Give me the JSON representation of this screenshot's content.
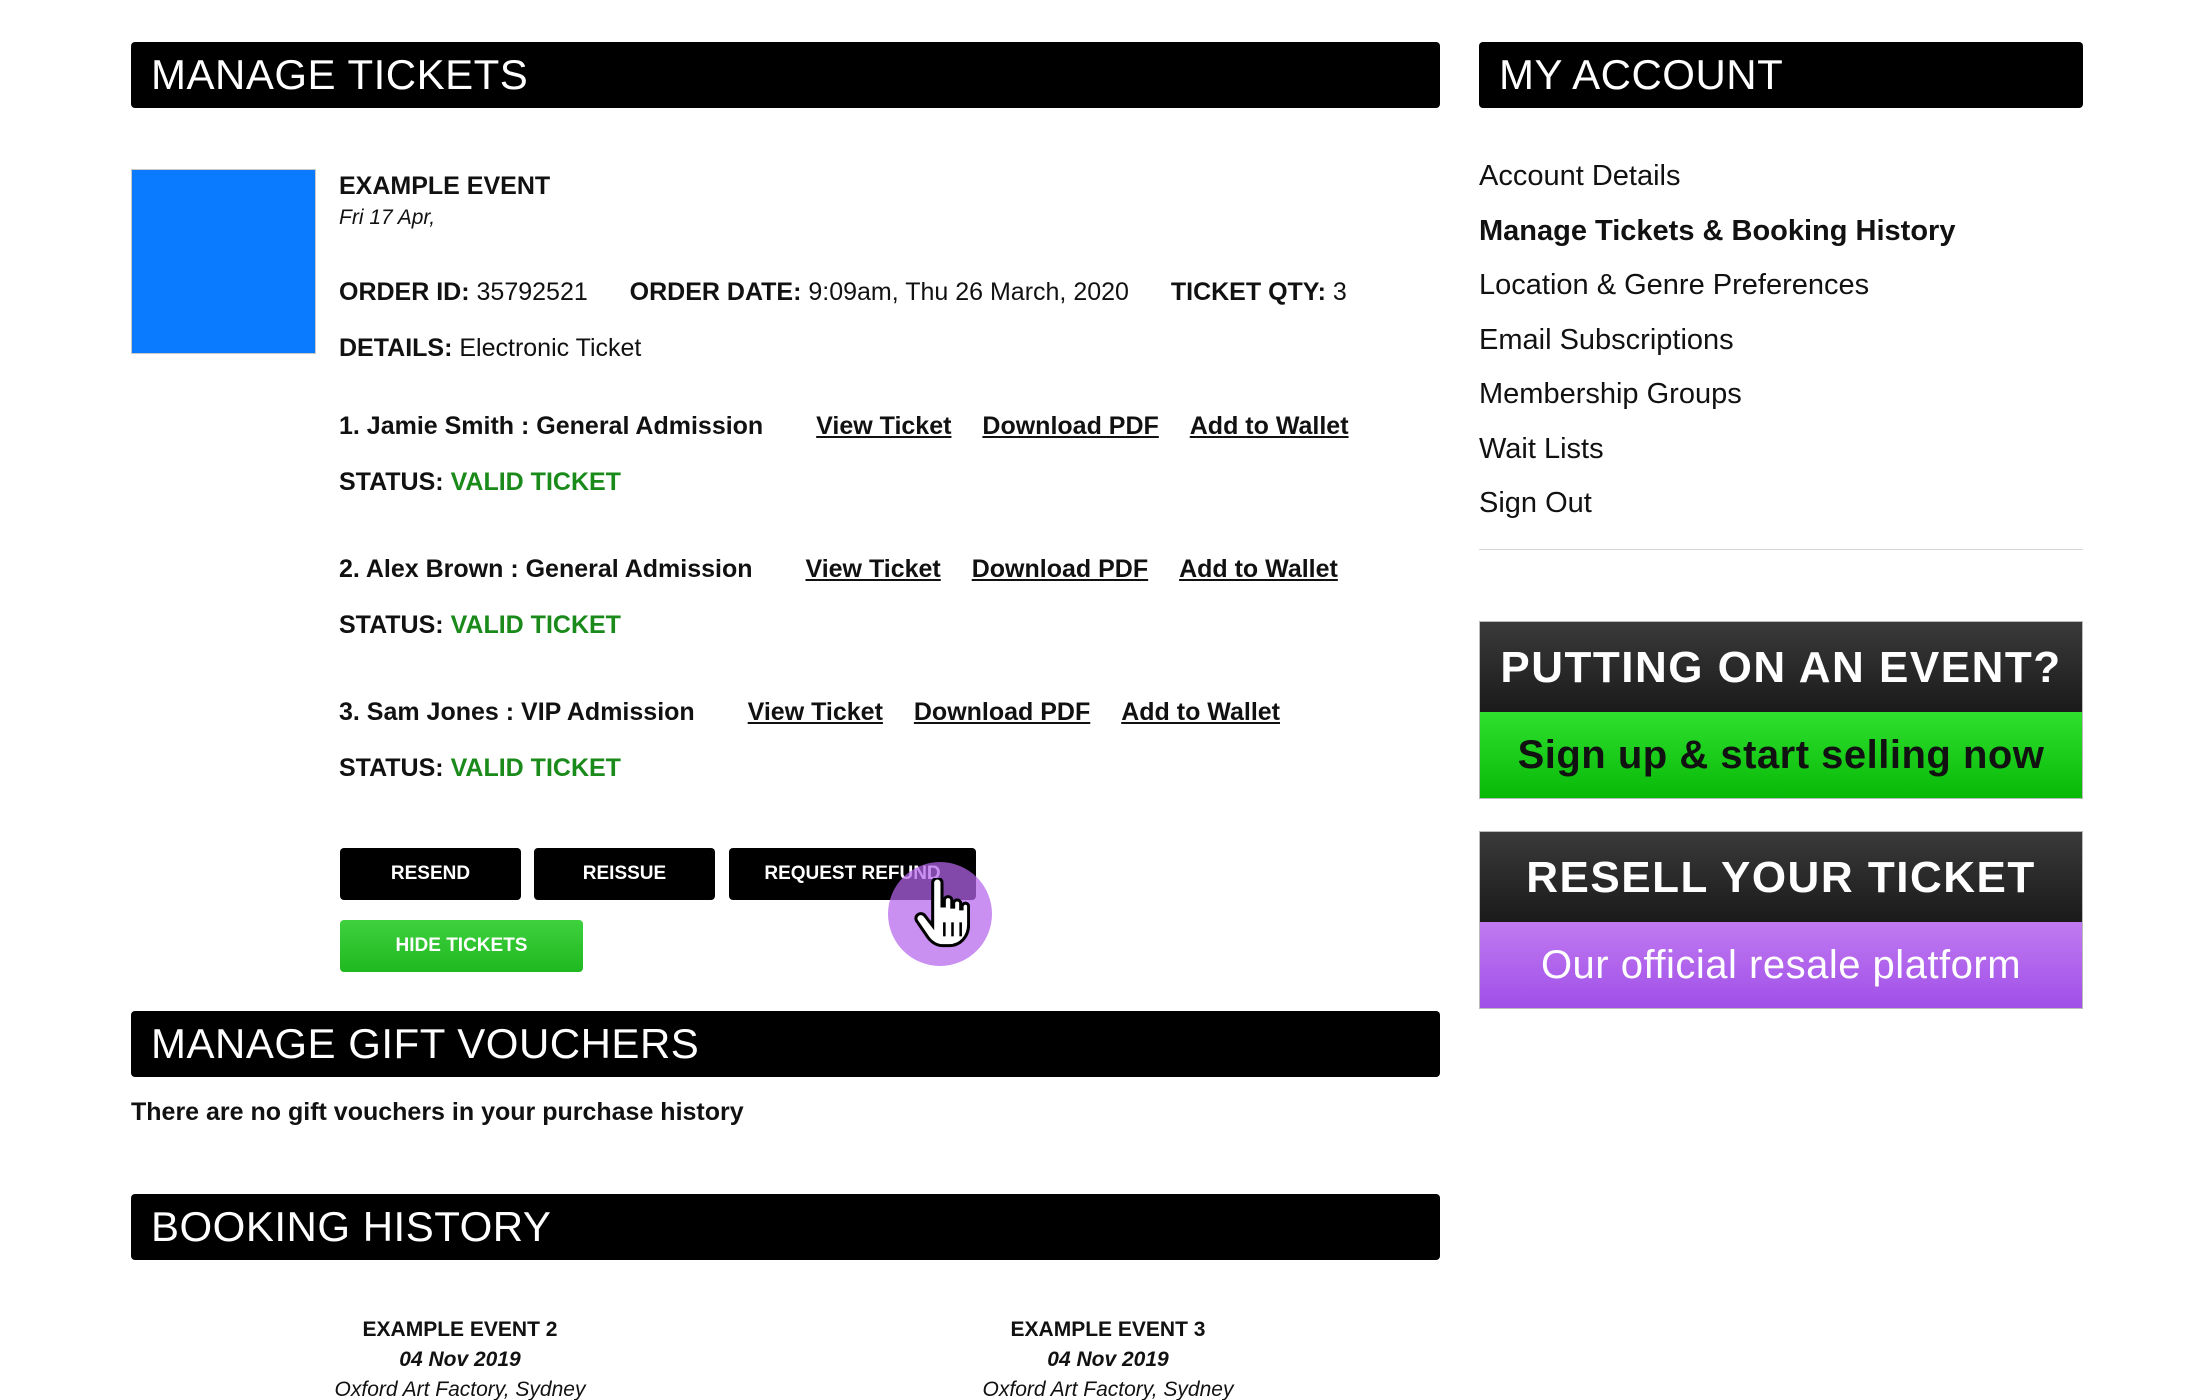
{
  "colors": {
    "event_thumbnail": "#0a7bff",
    "valid_status": "#1a8a1a",
    "hide_button": "#2ec52e",
    "resell_accent": "#a855f7"
  },
  "manage_tickets": {
    "heading": "MANAGE TICKETS",
    "event": {
      "title": "EXAMPLE EVENT",
      "date": "Fri 17 Apr,"
    },
    "order": {
      "order_id_label": "ORDER ID:",
      "order_id": "35792521",
      "order_date_label": "ORDER DATE:",
      "order_date": "9:09am, Thu 26 March, 2020",
      "qty_label": "TICKET QTY:",
      "qty": "3",
      "details_label": "DETAILS:",
      "details": "Electronic Ticket"
    },
    "tickets": [
      {
        "holder": "1. Jamie Smith : General Admission",
        "view": "View Ticket",
        "download": "Download PDF",
        "wallet": "Add to Wallet",
        "status_label": "STATUS:",
        "status": "VALID TICKET"
      },
      {
        "holder": "2. Alex Brown : General Admission",
        "view": "View Ticket",
        "download": "Download PDF",
        "wallet": "Add to Wallet",
        "status_label": "STATUS:",
        "status": "VALID TICKET"
      },
      {
        "holder": "3. Sam Jones : VIP Admission",
        "view": "View Ticket",
        "download": "Download PDF",
        "wallet": "Add to Wallet",
        "status_label": "STATUS:",
        "status": "VALID TICKET"
      }
    ],
    "actions": {
      "resend": "RESEND",
      "reissue": "REISSUE",
      "refund": "REQUEST REFUND",
      "hide": "HIDE TICKETS"
    }
  },
  "gift_vouchers": {
    "heading": "MANAGE GIFT VOUCHERS",
    "empty_text": "There are no gift vouchers in your purchase history"
  },
  "booking_history": {
    "heading": "BOOKING HISTORY",
    "items": [
      {
        "title": "EXAMPLE EVENT 2",
        "date": "04 Nov 2019",
        "venue": "Oxford Art Factory, Sydney"
      },
      {
        "title": "EXAMPLE EVENT 3",
        "date": "04 Nov 2019",
        "venue": "Oxford Art Factory, Sydney"
      }
    ]
  },
  "my_account": {
    "heading": "MY ACCOUNT",
    "items": [
      "Account Details",
      "Manage Tickets & Booking History",
      "Location & Genre Preferences",
      "Email Subscriptions",
      "Membership Groups",
      "Wait Lists",
      "Sign Out"
    ]
  },
  "promos": {
    "sell": {
      "headline": "PUTTING ON AN EVENT?",
      "cta": "Sign up & start selling now"
    },
    "resell": {
      "headline": "RESELL YOUR TICKET",
      "cta": "Our official resale platform"
    }
  }
}
